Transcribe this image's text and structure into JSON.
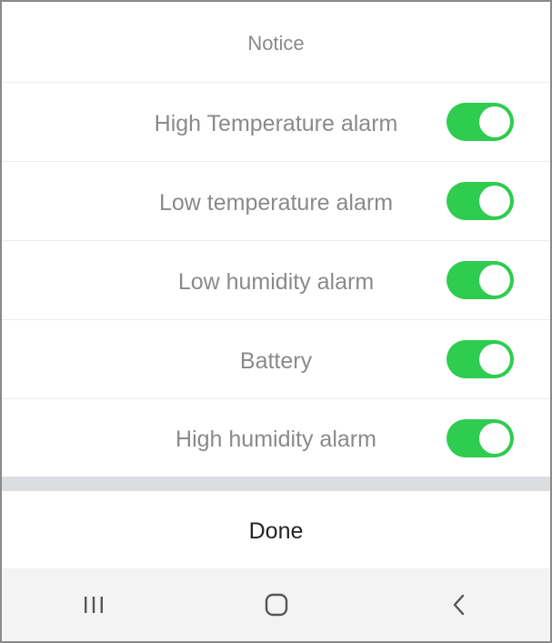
{
  "dialog": {
    "title": "Notice",
    "items": [
      {
        "label": "High Temperature alarm",
        "enabled": true
      },
      {
        "label": "Low temperature alarm",
        "enabled": true
      },
      {
        "label": "Low humidity alarm",
        "enabled": true
      },
      {
        "label": "Battery",
        "enabled": true
      },
      {
        "label": "High humidity alarm",
        "enabled": true
      }
    ],
    "done_label": "Done"
  },
  "navbar": {
    "buttons": [
      "recent-apps-icon",
      "home-icon",
      "back-icon"
    ]
  },
  "colors": {
    "toggle_on": "#2ecc4f",
    "divider_band": "#dcdde1",
    "navbar_bg": "#f3f3f3"
  }
}
